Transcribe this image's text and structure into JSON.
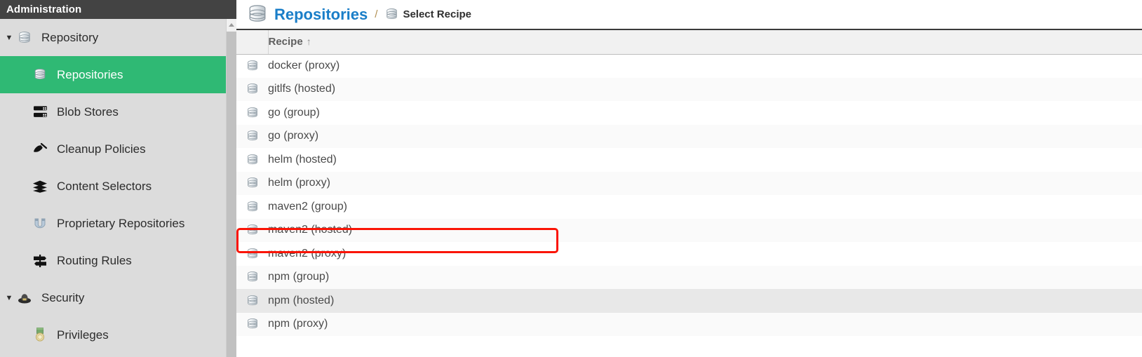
{
  "sidebar": {
    "header_title": "Administration",
    "groups": [
      {
        "label": "Repository",
        "icon": "database-icon",
        "expanded": true,
        "items": [
          {
            "label": "Repositories",
            "icon": "database-icon",
            "selected": true
          },
          {
            "label": "Blob Stores",
            "icon": "server-stack-icon",
            "selected": false
          },
          {
            "label": "Cleanup Policies",
            "icon": "broom-icon",
            "selected": false
          },
          {
            "label": "Content Selectors",
            "icon": "layers-icon",
            "selected": false
          },
          {
            "label": "Proprietary Repositories",
            "icon": "magnet-icon",
            "selected": false
          },
          {
            "label": "Routing Rules",
            "icon": "signpost-icon",
            "selected": false
          }
        ]
      },
      {
        "label": "Security",
        "icon": "shield-icon",
        "expanded": true,
        "items": [
          {
            "label": "Privileges",
            "icon": "medal-icon",
            "selected": false
          }
        ]
      }
    ],
    "caret_glyph": "▼"
  },
  "breadcrumb": {
    "root_label": "Repositories",
    "root_icon": "database-icon",
    "separator": "/",
    "current_label": "Select Recipe",
    "current_icon": "database-icon"
  },
  "table": {
    "columns": [
      {
        "key": "icon",
        "label": ""
      },
      {
        "key": "recipe",
        "label": "Recipe",
        "sorted": "asc",
        "sort_glyph": "↑"
      }
    ],
    "rows": [
      {
        "icon": "database-icon",
        "recipe": "docker (proxy)",
        "state": "normal"
      },
      {
        "icon": "database-icon",
        "recipe": "gitlfs (hosted)",
        "state": "normal"
      },
      {
        "icon": "database-icon",
        "recipe": "go (group)",
        "state": "normal"
      },
      {
        "icon": "database-icon",
        "recipe": "go (proxy)",
        "state": "normal"
      },
      {
        "icon": "database-icon",
        "recipe": "helm (hosted)",
        "state": "normal"
      },
      {
        "icon": "database-icon",
        "recipe": "helm (proxy)",
        "state": "normal"
      },
      {
        "icon": "database-icon",
        "recipe": "maven2 (group)",
        "state": "normal"
      },
      {
        "icon": "database-icon",
        "recipe": "maven2 (hosted)",
        "state": "annotated"
      },
      {
        "icon": "database-icon",
        "recipe": "maven2 (proxy)",
        "state": "normal"
      },
      {
        "icon": "database-icon",
        "recipe": "npm (group)",
        "state": "normal"
      },
      {
        "icon": "database-icon",
        "recipe": "npm (hosted)",
        "state": "hover"
      },
      {
        "icon": "database-icon",
        "recipe": "npm (proxy)",
        "state": "normal"
      }
    ]
  },
  "annotation": {
    "target_row_label": "maven2 (hosted)",
    "color": "#fa1405"
  },
  "colors": {
    "sidebar_header_bg": "#434343",
    "sidebar_bg": "#dcdcdc",
    "selected_item_bg": "#2fb974",
    "breadcrumb_link": "#1a7ec8",
    "table_header_bg": "#f1f1f1",
    "row_alt_bg": "#fafafa",
    "row_hover_bg": "#e8e8e8"
  },
  "scrollbar": {
    "up_arrow": "▲"
  }
}
